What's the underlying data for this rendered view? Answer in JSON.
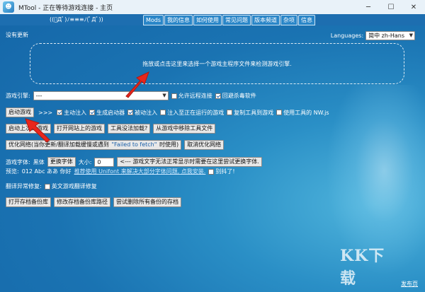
{
  "window": {
    "title": "MTool - 正在等待游戏连接 - 主页",
    "kaomoji": "((ﾟДﾟ)ﾉ≡≡≡ﾉ(ﾟДﾟ))"
  },
  "tabs": [
    {
      "label": "Mods"
    },
    {
      "label": "我的信息"
    },
    {
      "label": "如何使用"
    },
    {
      "label": "常见问题"
    },
    {
      "label": "版本频道"
    },
    {
      "label": "杂项"
    },
    {
      "label": "信息"
    }
  ],
  "status": {
    "update": "没有更新"
  },
  "language": {
    "label": "Languages:",
    "value": "简中 zh-Hans"
  },
  "dropzone": {
    "text": "拖放或点击这里来选择一个游戏主程序文件来检测游戏引擎."
  },
  "engine": {
    "label": "游戏引擎:",
    "value": "---",
    "options": [
      {
        "label": "允许远程连接",
        "checked": false
      },
      {
        "label": "回避杀毒软件",
        "checked": true
      }
    ]
  },
  "launch": {
    "button": "启动游戏",
    "arrows": ">>>",
    "options": [
      {
        "label": "主动注入",
        "checked": true
      },
      {
        "label": "生成启动器",
        "checked": true
      },
      {
        "label": "被动注入",
        "checked": true
      },
      {
        "label": "注入至正在运行的游戏",
        "checked": false
      },
      {
        "label": "复制工具到游戏",
        "checked": false
      },
      {
        "label": "使用工具的 NW.js",
        "checked": false
      }
    ]
  },
  "actions": {
    "launch_last": "启动上次的游戏",
    "open_site_game": "打开网站上的游戏",
    "tool_not_loaded": "工具没法加载?",
    "remove_tool": "从游戏中移除工具文件"
  },
  "optimize": {
    "prefix": "优化网络(当你更新/翻译加载缓慢或遇到",
    "error": "\"Failed to fetch\"",
    "suffix": "时使用)",
    "cancel": "取消优化网络"
  },
  "font": {
    "label": "游戏字体:",
    "name": "黑体",
    "change": "更换字体",
    "size_label": "大小:",
    "size_value": "0",
    "hint": "<--- 游戏文字无法正常显示时需要在这里尝试更换字体."
  },
  "preview": {
    "label": "预览:",
    "sample": "012 Abc ああ 你好",
    "link": "推荐使用 Unifont 来解决大部分字体问题, 点我安装.",
    "checkbox": "别抖了!",
    "checked": false
  },
  "repair": {
    "label": "翻译异常修复:",
    "option": "英文游戏翻译修复",
    "checked": false
  },
  "backup": {
    "open": "打开存档备份库",
    "modify": "修改存档备份库路径",
    "restore": "尝试删除所有备份的存档"
  },
  "footer": {
    "release": "发布页"
  },
  "watermark": "KK下载",
  "colors": {
    "background": "#1a73b2",
    "accent_arrow": "#e8261c",
    "titlebar": "#e9f2f9"
  }
}
